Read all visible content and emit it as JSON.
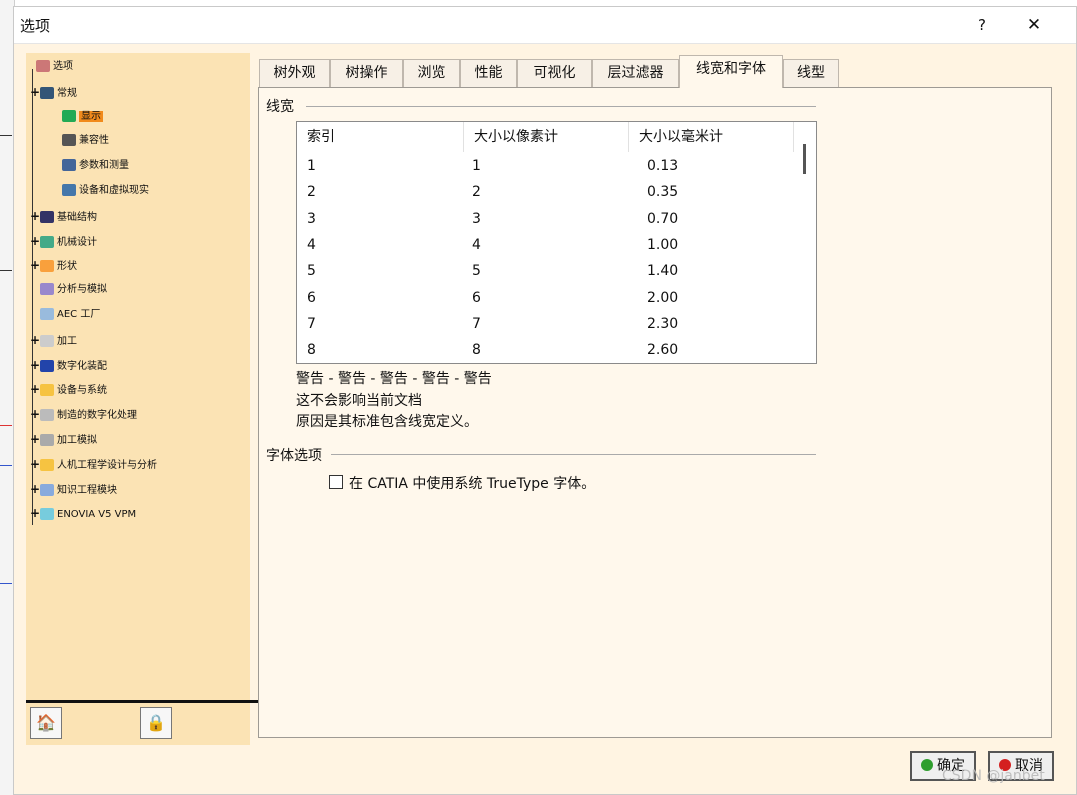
{
  "window": {
    "title": "选项",
    "help_label": "?",
    "close_label": "✕"
  },
  "tree": {
    "items": [
      {
        "label": "选项",
        "icon": "options-icon"
      },
      {
        "label": "常规",
        "icon": "general-icon"
      },
      {
        "label": "显示",
        "icon": "display-icon",
        "selected": true
      },
      {
        "label": "兼容性",
        "icon": "compatibility-icon"
      },
      {
        "label": "参数和测量",
        "icon": "parameters-icon"
      },
      {
        "label": "设备和虚拟现实",
        "icon": "devices-icon"
      },
      {
        "label": "基础结构",
        "icon": "infrastructure-icon"
      },
      {
        "label": "机械设计",
        "icon": "mechanical-design-icon"
      },
      {
        "label": "形状",
        "icon": "shape-icon"
      },
      {
        "label": "分析与模拟",
        "icon": "analysis-icon"
      },
      {
        "label": "AEC 工厂",
        "icon": "aec-plant-icon"
      },
      {
        "label": "加工",
        "icon": "machining-icon"
      },
      {
        "label": "数字化装配",
        "icon": "digital-mockup-icon"
      },
      {
        "label": "设备与系统",
        "icon": "equipment-icon"
      },
      {
        "label": "制造的数字化处理",
        "icon": "manufacturing-icon"
      },
      {
        "label": "加工模拟",
        "icon": "machining-sim-icon"
      },
      {
        "label": "人机工程学设计与分析",
        "icon": "ergonomics-icon"
      },
      {
        "label": "知识工程模块",
        "icon": "knowledgeware-icon"
      },
      {
        "label": "ENOVIA V5 VPM",
        "icon": "enovia-icon"
      }
    ],
    "toolbar": {
      "reset_icon": "reset-options-icon",
      "lock_icon": "lock-options-icon"
    }
  },
  "tabs": [
    {
      "label": "树外观"
    },
    {
      "label": "树操作"
    },
    {
      "label": "浏览"
    },
    {
      "label": "性能"
    },
    {
      "label": "可视化"
    },
    {
      "label": "层过滤器"
    },
    {
      "label": "线宽和字体",
      "active": true
    },
    {
      "label": "线型"
    }
  ],
  "linewidth": {
    "group_title": "线宽",
    "columns": [
      "索引",
      "大小以像素计",
      "大小以毫米计"
    ],
    "rows": [
      [
        "1",
        "1",
        "0.13"
      ],
      [
        "2",
        "2",
        "0.35"
      ],
      [
        "3",
        "3",
        "0.70"
      ],
      [
        "4",
        "4",
        "1.00"
      ],
      [
        "5",
        "5",
        "1.40"
      ],
      [
        "6",
        "6",
        "2.00"
      ],
      [
        "7",
        "7",
        "2.30"
      ],
      [
        "8",
        "8",
        "2.60"
      ]
    ],
    "warning_line": "警告 - 警告 - 警告 - 警告 - 警告",
    "note_1": "这不会影响当前文档",
    "note_2": "原因是其标准包含线宽定义。"
  },
  "font": {
    "group_title": "字体选项",
    "truetype_label": "在 CATIA 中使用系统 TrueType 字体。",
    "truetype_checked": false
  },
  "buttons": {
    "ok_label": "确定",
    "cancel_label": "取消"
  },
  "watermark": "CSDN @janbet"
}
